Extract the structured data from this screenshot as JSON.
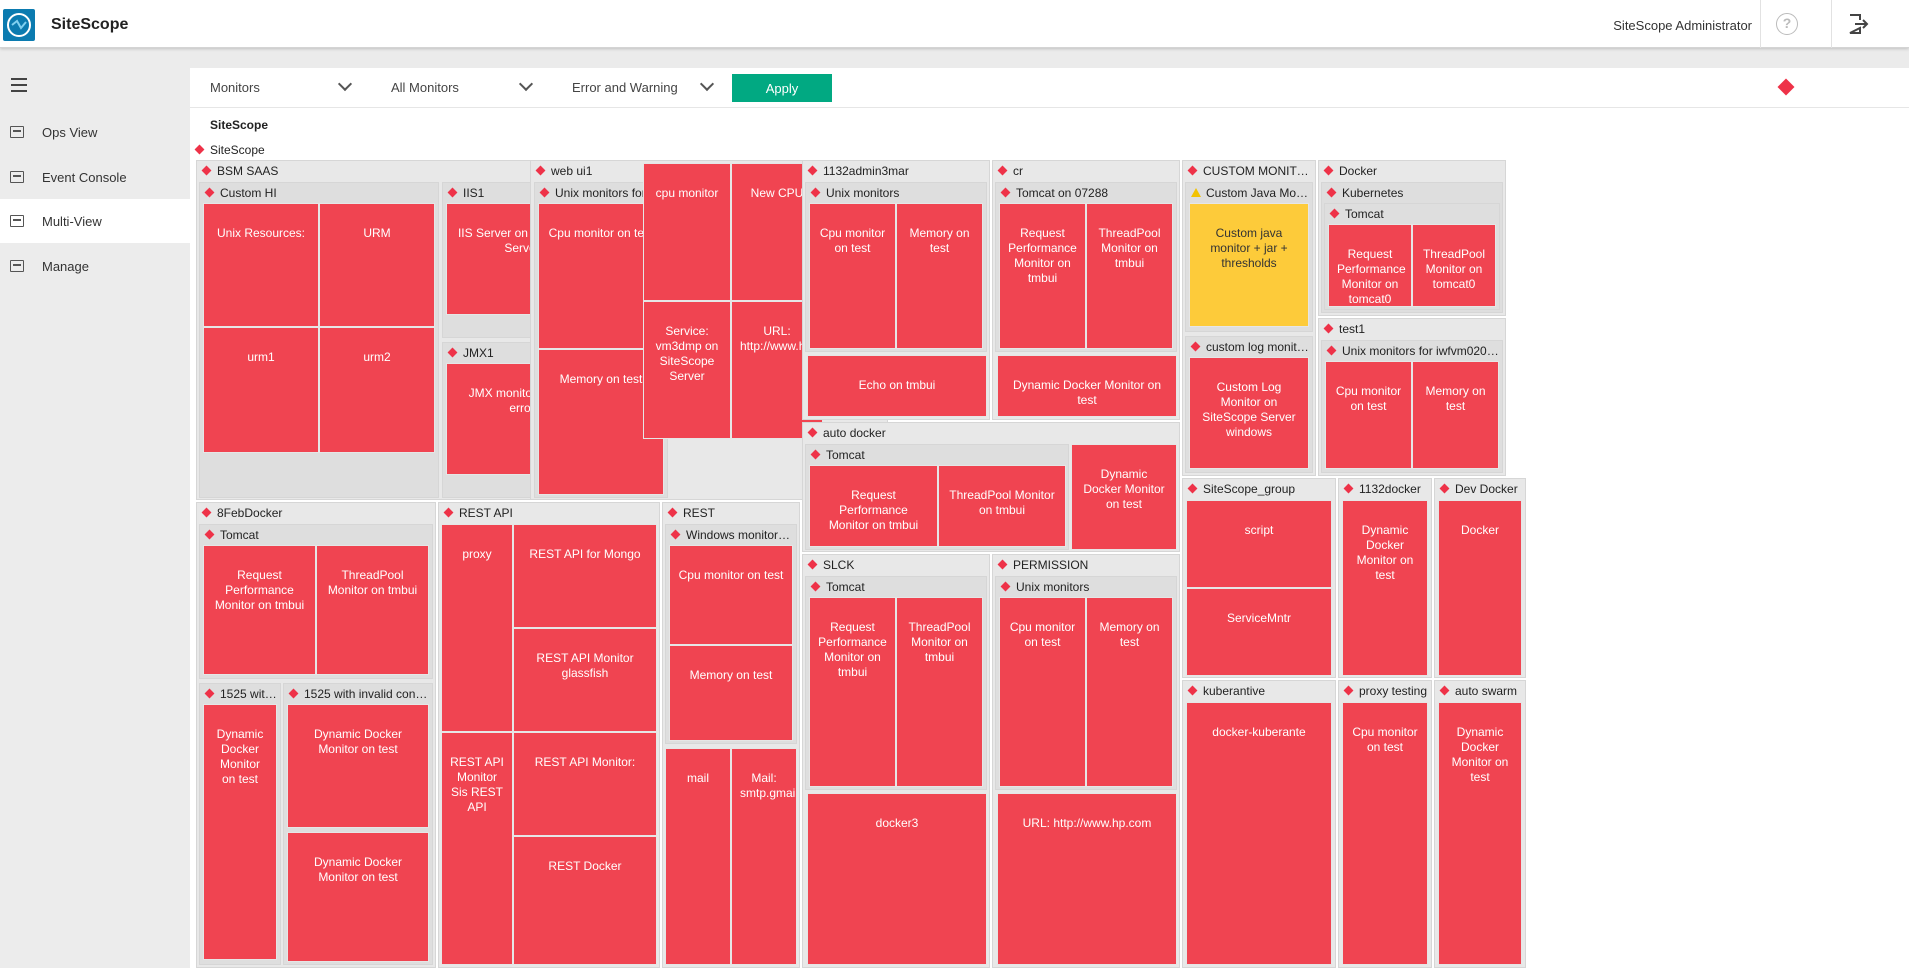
{
  "app": {
    "title": "SiteScope",
    "user": "SiteScope Administrator"
  },
  "colors": {
    "error": "#f04451",
    "warning": "#fdcb3a",
    "accent": "#01a982",
    "brand": "#0b7bb0"
  },
  "sidebar": {
    "items": [
      {
        "label": "Ops View",
        "icon": "ops-view-icon"
      },
      {
        "label": "Event Console",
        "icon": "event-console-icon"
      },
      {
        "label": "Multi-View",
        "icon": "multi-view-icon",
        "active": true
      },
      {
        "label": "Manage",
        "icon": "manage-icon"
      }
    ]
  },
  "filters": {
    "view": "Monitors",
    "scope": "All Monitors",
    "status": "Error and Warning",
    "apply_label": "Apply"
  },
  "breadcrumb": "SiteScope",
  "root_label": "SiteScope",
  "groups": {
    "bsm_saas": "BSM SAAS",
    "custom_hi": "Custom HI",
    "iis1": "IIS1",
    "jmx1": "JMX1",
    "web_ui1": "web ui1",
    "unix_test": "Unix monitors for t...",
    "admin3mar": "1132admin3mar",
    "unix_monitors": "Unix monitors",
    "cr": "cr",
    "tomcat_07288": "Tomcat on  07288",
    "custom_monitor": "CUSTOM MONITOR RE...",
    "custom_java": "Custom Java Monitor",
    "custom_log": "custom log monitor 1...",
    "docker": "Docker",
    "kubernetes": "Kubernetes",
    "tomcat": "Tomcat",
    "test1": "test1",
    "unix_iwfvm": "Unix monitors for iwfvm02076.hpswlabs.hp.com",
    "auto_docker": "auto docker",
    "feb_docker": "8FebDocker",
    "rest_api": "REST API",
    "rest": "REST",
    "windows_monitors": "Windows monitors for 16.183...",
    "c1525a": "1525 with co...",
    "c1525b": "1525 with invalid conatine...",
    "slck": "SLCK",
    "permission": "PERMISSION",
    "sitescope_group": "SiteScope_group",
    "docker1132": "1132docker",
    "dev_docker": "Dev Docker",
    "kuberantive": "kuberantive",
    "proxy_testing": "proxy testing",
    "auto_swarm": "auto swarm"
  },
  "tiles": {
    "unix_resources": "Unix Resources:",
    "urm": "URM",
    "urm1": "urm1",
    "urm2": "urm2",
    "iis_server": "IIS Server on SiteScope Server",
    "jmx_default": "JMX monitor default error",
    "cpu_on_test": "Cpu monitor on test",
    "cpu_monitor": "cpu monitor",
    "new_cpu": "New CPU",
    "memory_on_test": "Memory on test",
    "service_vm3dmp": "Service: vm3dmp on SiteScope Server",
    "url_hp_trunc": "URL: http://www.hp.co",
    "memory_on_test_b": "Memory on test",
    "echo_tmbui": "Echo on    tmbui",
    "request_perf_tmbui": "Request Performance Monitor on tmbui",
    "threadpool_tmbui": "ThreadPool Monitor on tmbui",
    "dynamic_docker": "Dynamic Docker Monitor on test",
    "custom_java_tile": "Custom java monitor + jar + thresholds",
    "custom_log_tile": "Custom Log Monitor on SiteScope Server windows",
    "request_perf_tomcat0": "Request Performance Monitor on tomcat0",
    "threadpool_tomcat0": "ThreadPool Monitor on tomcat0",
    "proxy": "proxy",
    "rest_mongo": "REST API for Mongo",
    "rest_glassfish": "REST API Monitor glassfish",
    "rest_monitor": "REST API Monitor:",
    "rest_sis": "REST API Monitor Sis REST API",
    "rest_docker": "REST Docker",
    "memory_on_test_c": "Memory  on test",
    "mail": "mail",
    "mail_smtp": "Mail: smtp.gmail.con",
    "dynamic_docker_test": "Dynamic Docker Monitor on test",
    "dynamic_docker_short": "Dynamic Docker Monitor on test",
    "docker3": "docker3",
    "url_hp": "URL: http://www.hp.com",
    "script": "script",
    "service_mntr": "ServiceMntr",
    "docker_kuberante": "docker-kuberante",
    "docker_tile": "Docker"
  }
}
